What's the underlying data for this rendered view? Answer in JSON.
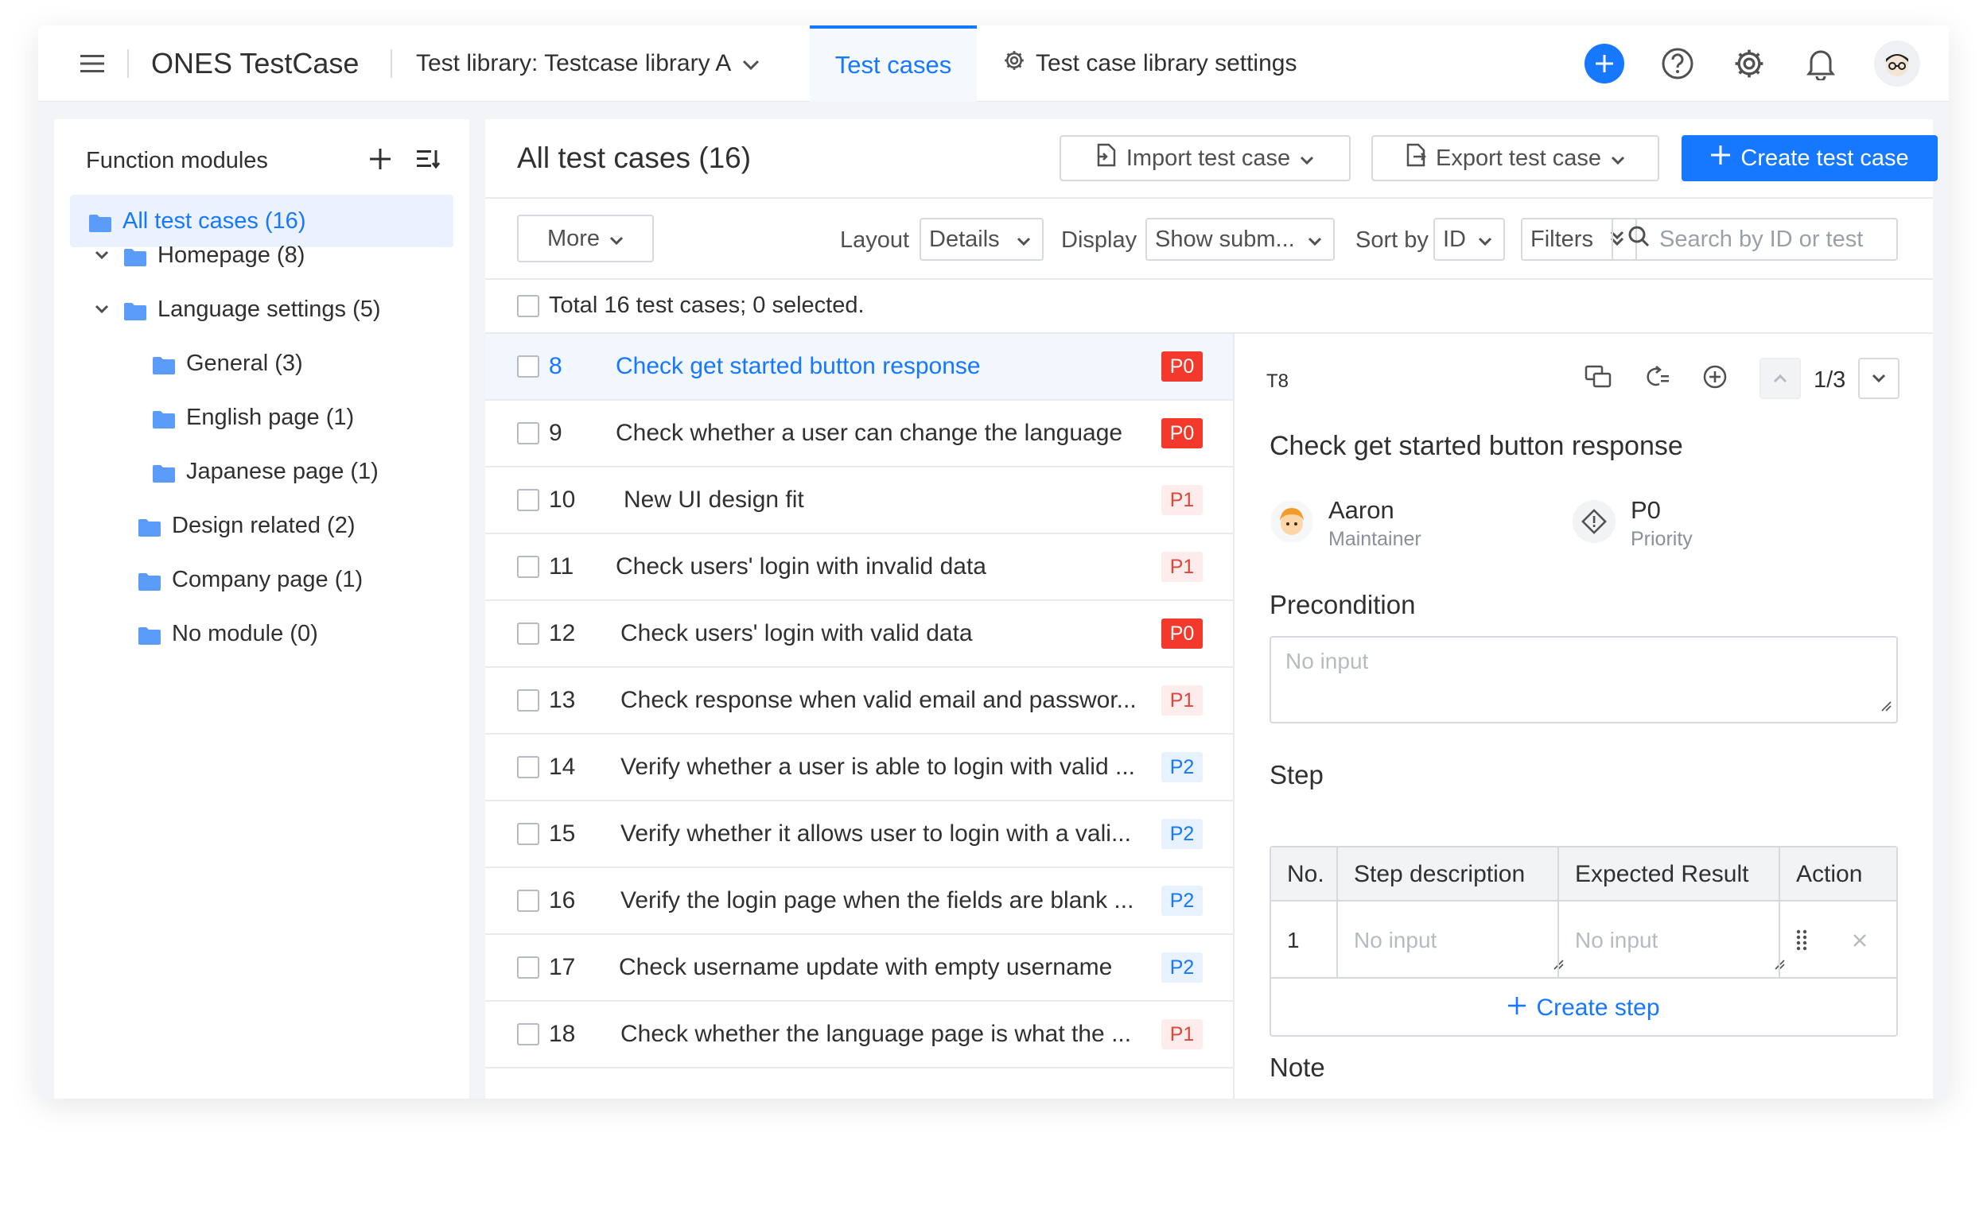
{
  "topbar": {
    "brand": "ONES TestCase",
    "library": "Test library: Testcase library A",
    "active_tab": "Test cases",
    "settings_tab": "Test case library settings"
  },
  "sidebar": {
    "title": "Function modules",
    "items": [
      {
        "label": "All test cases (16)"
      },
      {
        "label": "Homepage (8)"
      },
      {
        "label": "Language settings (5)"
      },
      {
        "label": "General (3)"
      },
      {
        "label": "English page (1)"
      },
      {
        "label": "Japanese page (1)"
      },
      {
        "label": "Design related (2)"
      },
      {
        "label": "Company page (1)"
      },
      {
        "label": "No module (0)"
      }
    ]
  },
  "main": {
    "title": "All test cases (16)",
    "import_label": "Import test case",
    "export_label": "Export test case",
    "create_label": "Create test case",
    "more_label": "More",
    "layout_label": "Layout",
    "layout_value": "Details",
    "display_label": "Display",
    "display_value": "Show subm...",
    "sort_label": "Sort by",
    "sort_value": "ID",
    "filters_label": "Filters",
    "search_placeholder": "Search by ID or test",
    "total_text": "Total 16 test cases; 0 selected."
  },
  "cases": [
    {
      "id": "8",
      "title": "Check get started button response",
      "priority": "P0"
    },
    {
      "id": "9",
      "title": "Check whether a user can change the language",
      "priority": "P0"
    },
    {
      "id": "10",
      "title": "New UI design fit",
      "priority": "P1"
    },
    {
      "id": "11",
      "title": "Check users' login with invalid data",
      "priority": "P1"
    },
    {
      "id": "12",
      "title": "Check users' login with valid data",
      "priority": "P0"
    },
    {
      "id": "13",
      "title": "Check response when valid email and passwor...",
      "priority": "P1"
    },
    {
      "id": "14",
      "title": "Verify whether a user is able to login with valid ...",
      "priority": "P2"
    },
    {
      "id": "15",
      "title": "Verify whether it allows user to login with a vali...",
      "priority": "P2"
    },
    {
      "id": "16",
      "title": "Verify the login page when the fields are blank ...",
      "priority": "P2"
    },
    {
      "id": "17",
      "title": "Check username update with empty username",
      "priority": "P2"
    },
    {
      "id": "18",
      "title": "Check whether the language page is what the ...",
      "priority": "P1"
    }
  ],
  "detail": {
    "code": "T8",
    "pager": "1/3",
    "title": "Check get started button response",
    "maintainer_name": "Aaron",
    "maintainer_label": "Maintainer",
    "priority_value": "P0",
    "priority_label": "Priority",
    "precondition_heading": "Precondition",
    "precondition_placeholder": "No input",
    "step_heading": "Step",
    "step_columns": [
      "No.",
      "Step description",
      "Expected Result",
      "Action"
    ],
    "step_row": {
      "no": "1",
      "description_placeholder": "No input",
      "expected_placeholder": "No input"
    },
    "create_step": "Create step",
    "note_heading": "Note"
  }
}
